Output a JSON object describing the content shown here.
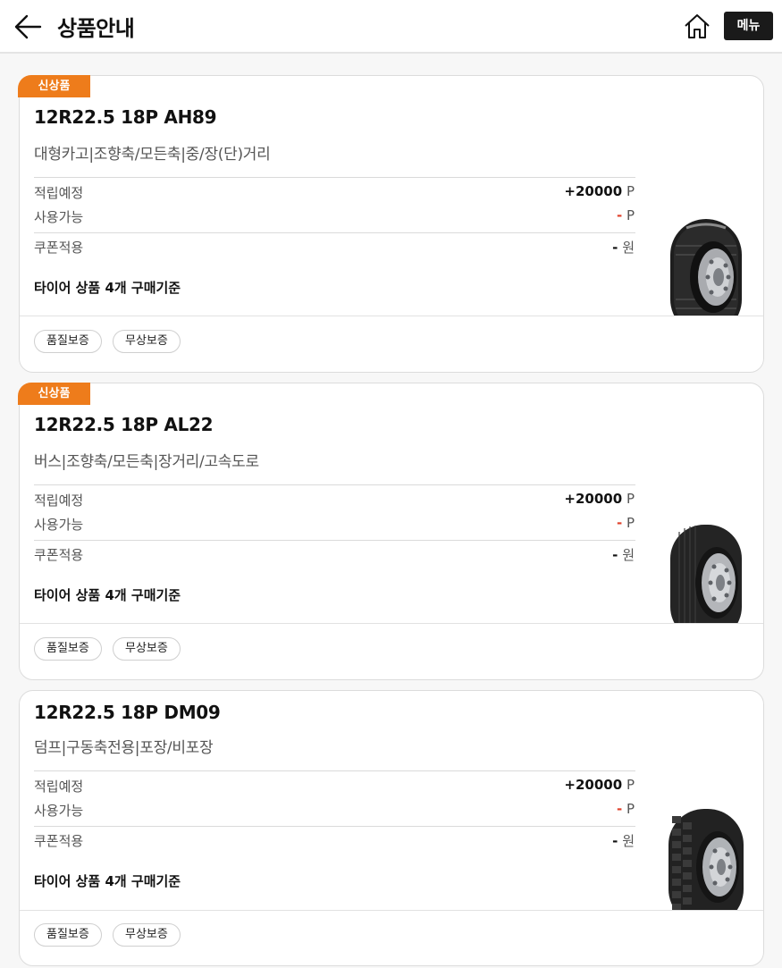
{
  "header": {
    "title": "상품안내",
    "menu_label": "메뉴"
  },
  "products": [
    {
      "badge": "신상품",
      "name": "12R22.5 18P AH89",
      "desc": "대형카고|조향축/모든축|중/장(단)거리",
      "earn_label": "적립예정",
      "earn_value": "+20000",
      "earn_unit": "P",
      "avail_label": "사용가능",
      "avail_value": "-",
      "avail_unit": "P",
      "coupon_label": "쿠폰적용",
      "coupon_value": "-",
      "coupon_unit": "원",
      "note": "타이어 상품 4개 구매기준",
      "tags": [
        "품질보증",
        "무상보증"
      ]
    },
    {
      "badge": "신상품",
      "name": "12R22.5 18P AL22",
      "desc": "버스|조향축/모든축|장거리/고속도로",
      "earn_label": "적립예정",
      "earn_value": "+20000",
      "earn_unit": "P",
      "avail_label": "사용가능",
      "avail_value": "-",
      "avail_unit": "P",
      "coupon_label": "쿠폰적용",
      "coupon_value": "-",
      "coupon_unit": "원",
      "note": "타이어 상품 4개 구매기준",
      "tags": [
        "품질보증",
        "무상보증"
      ]
    },
    {
      "badge": "",
      "name": "12R22.5 18P DM09",
      "desc": "덤프|구동축전용|포장/비포장",
      "earn_label": "적립예정",
      "earn_value": "+20000",
      "earn_unit": "P",
      "avail_label": "사용가능",
      "avail_value": "-",
      "avail_unit": "P",
      "coupon_label": "쿠폰적용",
      "coupon_value": "-",
      "coupon_unit": "원",
      "note": "타이어 상품 4개 구매기준",
      "tags": [
        "품질보증",
        "무상보증"
      ]
    }
  ],
  "colors": {
    "badge": "#ee7c1b",
    "accent_red": "#e0402a",
    "menu_button": "#1a1a1a"
  },
  "icons": [
    "back-arrow-icon",
    "home-icon",
    "tire-image"
  ]
}
